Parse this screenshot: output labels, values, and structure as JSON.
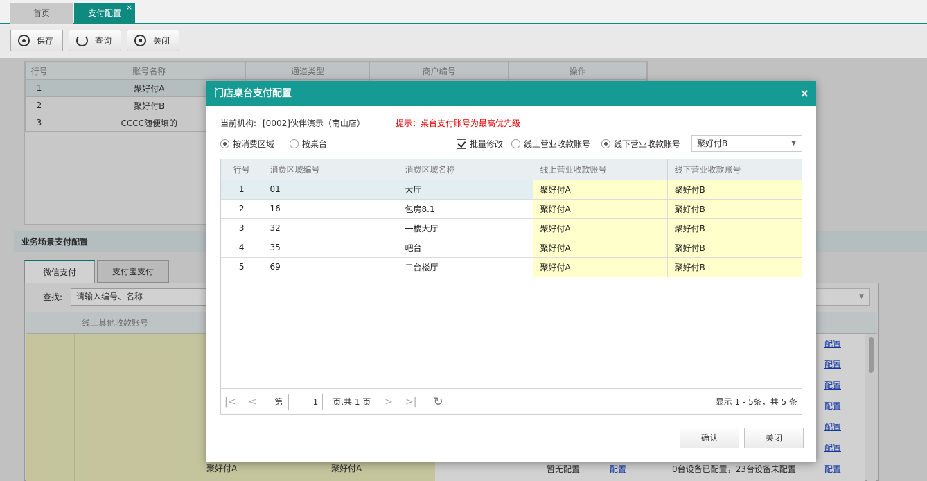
{
  "tabs": {
    "home": "首页",
    "active": "支付配置",
    "close_glyph": "×"
  },
  "toolbar": {
    "save": "保存",
    "query": "查询",
    "close": "关闭"
  },
  "background": {
    "account_table": {
      "headers": [
        "行号",
        "账号名称",
        "通道类型",
        "商户编号",
        "操作"
      ],
      "rows": [
        {
          "no": "1",
          "name": "聚好付A"
        },
        {
          "no": "2",
          "name": "聚好付B"
        },
        {
          "no": "3",
          "name": "CCCC随便填的"
        }
      ]
    },
    "section_title": "业务场景支付配置",
    "scene_tabs": [
      "微信支付",
      "支付宝支付"
    ],
    "search_label": "查找:",
    "search_placeholder": "请输入编号、名称",
    "scene_header": "线上其他收款账号",
    "config_link": "配置",
    "last_row": {
      "col1": "聚好付A",
      "col2": "聚好付A",
      "status": "暂无配置",
      "config": "配置",
      "devices": "0台设备已配置，23台设备未配置",
      "config2": "配置"
    }
  },
  "dialog": {
    "title": "门店桌台支付配置",
    "close_glyph": "×",
    "org_label": "当前机构:",
    "org_value": "[0002]伙伴演示（南山店）",
    "hint": "提示：桌台支付账号为最高优先级",
    "mode_area": "按消费区域",
    "mode_table": "按桌台",
    "batch_edit": "批量修改",
    "opt_online": "线上营业收款账号",
    "opt_offline": "线下营业收款账号",
    "account_select": "聚好付B",
    "columns": [
      "行号",
      "消费区域编号",
      "消费区域名称",
      "线上营业收款账号",
      "线下营业收款账号"
    ],
    "rows": [
      {
        "no": "1",
        "code": "01",
        "name": "大厅",
        "online": "聚好付A",
        "offline": "聚好付B"
      },
      {
        "no": "2",
        "code": "16",
        "name": "包房8.1",
        "online": "聚好付A",
        "offline": "聚好付B"
      },
      {
        "no": "3",
        "code": "32",
        "name": "一楼大厅",
        "online": "聚好付A",
        "offline": "聚好付B"
      },
      {
        "no": "4",
        "code": "35",
        "name": "吧台",
        "online": "聚好付A",
        "offline": "聚好付B"
      },
      {
        "no": "5",
        "code": "69",
        "name": "二台楼厅",
        "online": "聚好付A",
        "offline": "聚好付B"
      }
    ],
    "pager": {
      "page_prefix": "第",
      "page": "1",
      "page_suffix": "页,共 1 页",
      "summary": "显示 1 - 5条，共 5 条"
    },
    "confirm": "确认",
    "close": "关闭"
  },
  "colors": {
    "accent": "#159a94",
    "row_highlight": "#ffffcc",
    "hint": "#e60000",
    "link": "#1a44c9"
  }
}
